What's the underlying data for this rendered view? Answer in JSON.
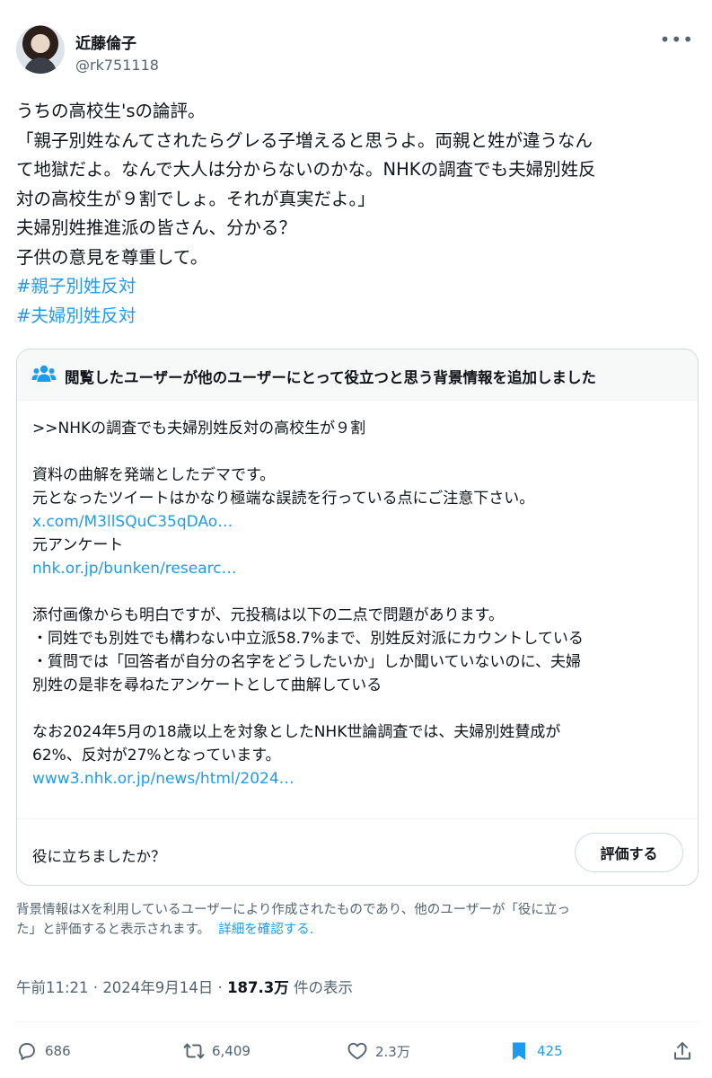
{
  "author": {
    "display_name": "近藤倫子",
    "handle": "@rk751118"
  },
  "tweet": {
    "lines": [
      "うちの高校生'sの論評。",
      "「親子別姓なんてされたらグレる子増えると思うよ。両親と姓が違うなん",
      "て地獄だよ。なんで大人は分からないのかな。NHKの調査でも夫婦別姓反",
      "対の高校生が９割でしょ。それが真実だよ。」",
      "夫婦別姓推進派の皆さん、分かる？",
      "子供の意見を尊重して。"
    ],
    "hashtags": [
      "#親子別姓反対",
      "#夫婦別姓反対"
    ]
  },
  "community_note": {
    "title": "閲覧したユーザーが他のユーザーにとって役立つと思う背景情報を追加しました",
    "quote": ">>NHKの調査でも夫婦別姓反対の高校生が９割",
    "para1": [
      "資料の曲解を発端としたデマです。",
      "元となったツイートはかなり極端な誤読を行っている点にご注意下さい。"
    ],
    "link1": "x.com/M3llSQuC35qDAo…",
    "source_label": "元アンケート",
    "link2": "nhk.or.jp/bunken/researc…",
    "para2": [
      "添付画像からも明白ですが、元投稿は以下の二点で問題があります。",
      "・同姓でも別姓でも構わない中立派58.7%まで、別姓反対派にカウントしている",
      "・質問では「回答者が自分の名字をどうしたいか」しか聞いていないのに、夫婦",
      "別姓の是非を尋ねたアンケートとして曲解している"
    ],
    "para3": [
      "なお2024年5月の18歳以上を対象としたNHK世論調査では、夫婦別姓賛成が",
      "62%、反対が27%となっています。"
    ],
    "link3": "www3.nhk.or.jp/news/html/2024…",
    "helpful_question": "役に立ちましたか？",
    "rate_button": "評価する"
  },
  "disclaimer": {
    "line1": "背景情報はXを利用しているユーザーにより作成されたものであり、他のユーザーが「役に立っ",
    "line2": "た」と評価すると表示されます。",
    "learn_more": "詳細を確認する."
  },
  "meta": {
    "time": "午前11:21",
    "date": "2024年9月14日",
    "views_count": "187.3万",
    "views_label": "件の表示",
    "separator": "·"
  },
  "actions": {
    "replies": "686",
    "reposts": "6,409",
    "likes": "2.3万",
    "bookmarks": "425"
  },
  "colors": {
    "accent": "#1d9bf0",
    "text": "#0f1419",
    "secondary": "#536471",
    "border": "#cfd9de"
  }
}
